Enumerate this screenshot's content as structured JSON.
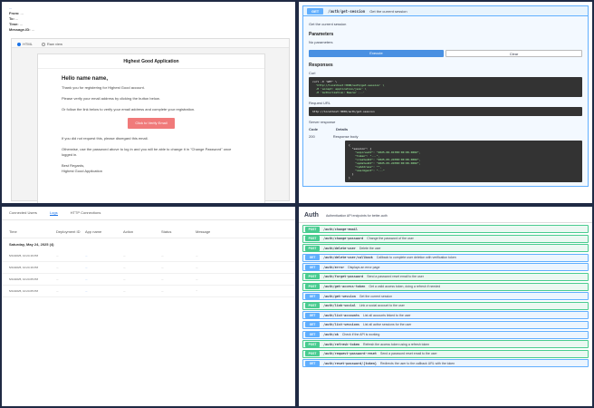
{
  "email_preview": {
    "header_link": "...",
    "from": "...",
    "to": "...",
    "time": "...",
    "message_id": "...",
    "tabs": [
      "HTML",
      "Raw view"
    ],
    "title": "Highest Good Application",
    "greeting": "Hello name name,",
    "paragraphs": [
      "Thank you for registering for Highest Good account.",
      "Please verify your email address by clicking the button below.",
      "Or follow the link below to verify your email address and complete your registration."
    ],
    "button_label": "Click to Verify Email",
    "after_paragraphs": [
      "If you did not request this, please disregard this email.",
      "Otherwise, use the password above to log in and you will be able to change it in \"Change Password\" once logged in."
    ],
    "sign_off": [
      "Best Regards,",
      "Highest Good Application"
    ]
  },
  "swagger_response": {
    "method": "GET",
    "path": "/auth/get-session",
    "summary": "Get the current session",
    "description": "Get the current session",
    "parameters_label": "Parameters",
    "no_params": "No parameters",
    "execute_label": "Execute",
    "clear_label": "Clear",
    "responses_label": "Responses",
    "curl_label": "Curl",
    "curl_lines": [
      "curl -X 'GET' \\",
      "  'http://localhost:3000/auth/get-session' \\",
      "  -H 'accept: application/json' \\",
      "  -H 'Authorization: Bearer ...'"
    ],
    "request_url_label": "Request URL",
    "request_url": "http://localhost:3000/auth/get-session",
    "server_response_label": "Server response",
    "code_header": "Code",
    "details_header": "Details",
    "code": "200",
    "response_body_label": "Response body",
    "response_lines": [
      "{",
      "  \"session\": {",
      "    \"expiresAt\": \"2025-06-01T00:00:00.000Z\",",
      "    \"token\": \"...\",",
      "    \"createdAt\": \"2025-05-24T00:00:00.000Z\",",
      "    \"updatedAt\": \"2025-05-24T00:00:00.000Z\",",
      "    \"ipAddress\": \"\",",
      "    \"userAgent\": \"...\"",
      "  }",
      "}"
    ]
  },
  "logs": {
    "tabs": [
      "Connected Users",
      "Logs",
      "HTTP Connections"
    ],
    "active_tab": "Logs",
    "columns": [
      "Time",
      "Deployment ID",
      "App name",
      "Action",
      "Status",
      "Message"
    ],
    "day_heading": "Saturday, May 24, 2025 (4)",
    "rows": [
      {
        "time": "5/24/2025, 10:24:16 PM",
        "deployment": "...",
        "app": "...",
        "action": "...",
        "status": "...",
        "message": "..."
      },
      {
        "time": "5/24/2025, 10:24:16 PM",
        "deployment": "...",
        "app": "...",
        "action": "...",
        "status": "...",
        "message": "..."
      },
      {
        "time": "5/24/2025, 10:24:05 PM",
        "deployment": "...",
        "app": "...",
        "action": "...",
        "status": "...",
        "message": "..."
      },
      {
        "time": "5/24/2025, 10:24:05 PM",
        "deployment": "...",
        "app": "...",
        "action": "...",
        "status": "...",
        "message": "..."
      }
    ]
  },
  "auth": {
    "title": "Auth",
    "description": "Authentication API endpoints for better-auth",
    "operations": [
      {
        "method": "POST",
        "path": "/auth/change-email",
        "summary": ""
      },
      {
        "method": "POST",
        "path": "/auth/change-password",
        "summary": "Change the password of the user"
      },
      {
        "method": "POST",
        "path": "/auth/delete-user",
        "summary": "Delete the user"
      },
      {
        "method": "GET",
        "path": "/auth/delete-user/callback",
        "summary": "Callback to complete user deletion with verification token"
      },
      {
        "method": "GET",
        "path": "/auth/error",
        "summary": "Displays an error page"
      },
      {
        "method": "POST",
        "path": "/auth/forget-password",
        "summary": "Send a password reset email to the user"
      },
      {
        "method": "POST",
        "path": "/auth/get-access-token",
        "summary": "Get a valid access token, doing a refresh if needed"
      },
      {
        "method": "GET",
        "path": "/auth/get-session",
        "summary": "Get the current session"
      },
      {
        "method": "POST",
        "path": "/auth/link-social",
        "summary": "Link a social account to the user"
      },
      {
        "method": "GET",
        "path": "/auth/list-accounts",
        "summary": "List all accounts linked to the user"
      },
      {
        "method": "GET",
        "path": "/auth/list-sessions",
        "summary": "List all active sessions for the user"
      },
      {
        "method": "GET",
        "path": "/auth/ok",
        "summary": "Check if the API is working"
      },
      {
        "method": "POST",
        "path": "/auth/refresh-token",
        "summary": "Refresh the access token using a refresh token"
      },
      {
        "method": "POST",
        "path": "/auth/request-password-reset",
        "summary": "Send a password reset email to the user"
      },
      {
        "method": "GET",
        "path": "/auth/reset-password/{token}",
        "summary": "Redirects the user to the callback URL with the token"
      }
    ]
  }
}
